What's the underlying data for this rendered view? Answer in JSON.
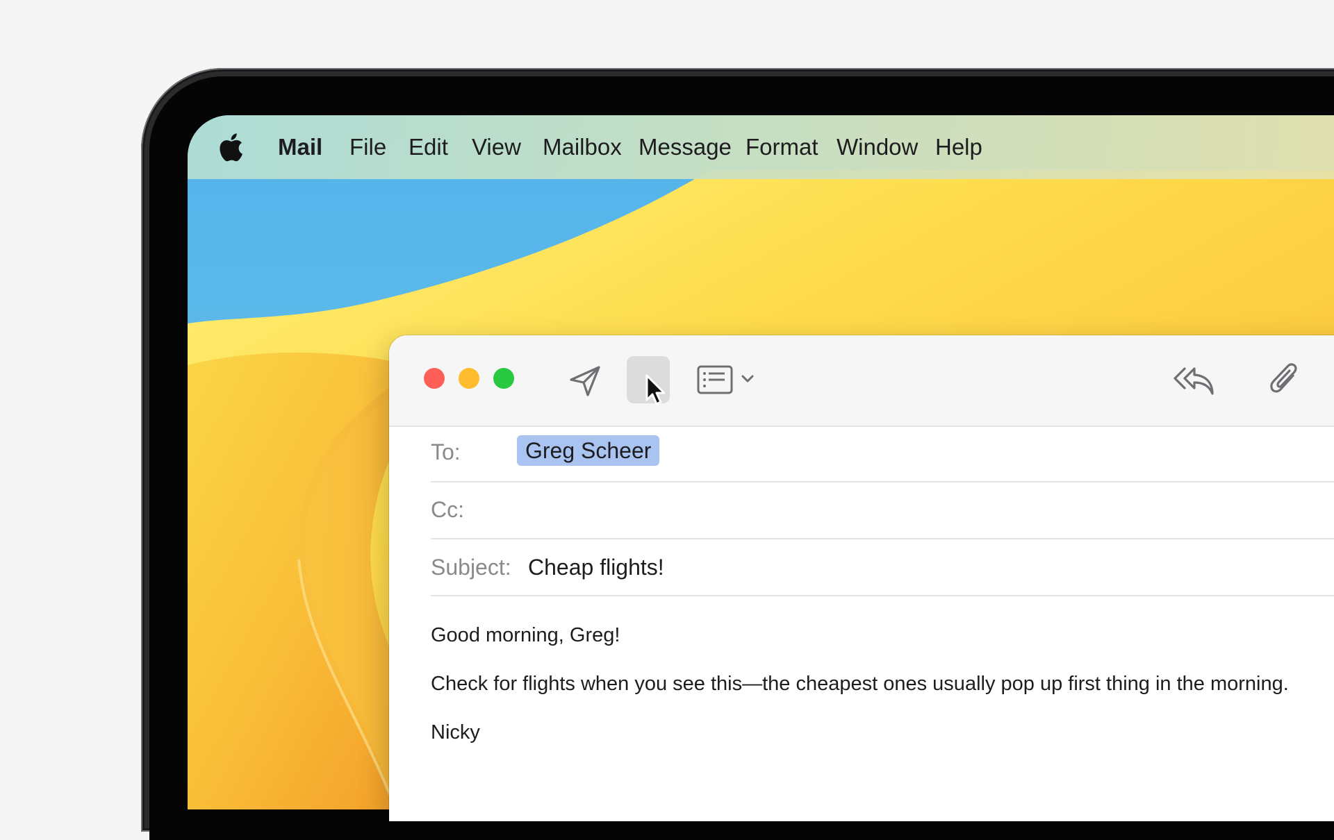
{
  "menubar": {
    "apple_icon": "apple-icon",
    "items": [
      "Mail",
      "File",
      "Edit",
      "View",
      "Mailbox",
      "Message",
      "Format",
      "Window",
      "Help"
    ]
  },
  "toolbar": {
    "icons": [
      "close-button",
      "minimize-button",
      "zoom-button",
      "send-icon",
      "header-fields-icon",
      "reply-all-icon",
      "paperclip-icon"
    ]
  },
  "compose": {
    "to_label": "To:",
    "to_recipient": "Greg Scheer",
    "cc_label": "Cc:",
    "subject_label": "Subject:",
    "subject_value": "Cheap flights!",
    "body": [
      "Good morning, Greg!",
      "Check for flights when you see this—the cheapest ones usually pop up first thing in the morning.",
      "Nicky"
    ]
  },
  "colors": {
    "close": "#fe5f57",
    "minimize": "#febc2e",
    "zoom": "#28c840",
    "token": "#a9c4f0",
    "wallpaper_blue": "#55b6ea",
    "wallpaper_yellow": "#fed444",
    "wallpaper_orange": "#f7a731"
  }
}
